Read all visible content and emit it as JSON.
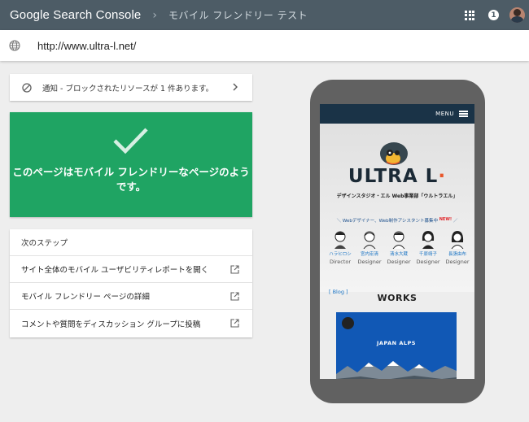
{
  "header": {
    "brand": "Google Search Console",
    "separator": "›",
    "tool_name": "モバイル フレンドリー テスト",
    "notification_count": "1"
  },
  "url_bar": {
    "url": "http://www.ultra-l.net/"
  },
  "notice": {
    "text": "通知 - ブロックされたリソースが 1 件あります。"
  },
  "result": {
    "line1": "このページはモバイル フレンドリーなページのよう",
    "line2": "です。",
    "color": "#1fa463"
  },
  "next_steps": {
    "heading": "次のステップ",
    "items": [
      {
        "label": "サイト全体のモバイル ユーザビリティレポートを開く"
      },
      {
        "label": "モバイル フレンドリー ページの詳細"
      },
      {
        "label": "コメントや質問をディスカッション グループに投稿"
      }
    ]
  },
  "preview": {
    "menu_label": "MENU",
    "logo": "ULTRA L",
    "logo_mark": "·",
    "tagline": "デザインスタジオ・エル Web事業部「ウルトラエル」",
    "recruit": "＼ Webデザイナー、Web制作アシスタント募集中",
    "recruit_end": "／",
    "new_badge": "NEW!",
    "staff": [
      {
        "name": "ハラヒロシ",
        "role": "Director"
      },
      {
        "name": "宮内宏清",
        "role": "Designer"
      },
      {
        "name": "清水大蔵",
        "role": "Designer"
      },
      {
        "name": "千原靖子",
        "role": "Designer"
      },
      {
        "name": "長張由布",
        "role": "Designer"
      }
    ],
    "blog_link": "[ Blog ]",
    "works_title": "WORKS",
    "thumb_title": "JAPAN ALPS"
  },
  "colors": {
    "topbar": "#4d5c66",
    "success": "#1fa463",
    "phone_frame": "#616161"
  }
}
